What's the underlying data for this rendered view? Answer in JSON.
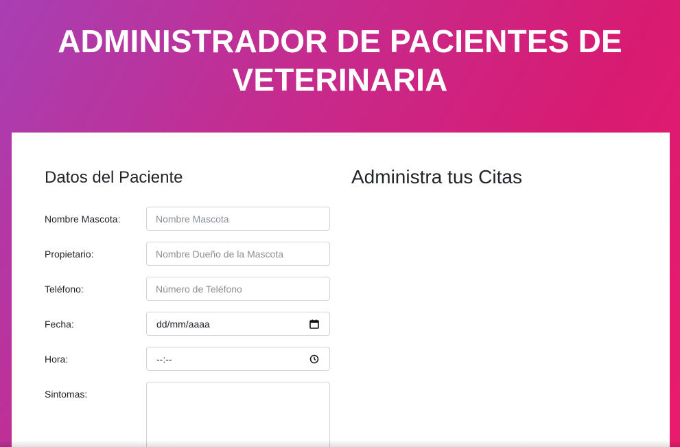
{
  "header": {
    "title": "ADMINISTRADOR DE PACIENTES DE VETERINARIA"
  },
  "form": {
    "title": "Datos del Paciente",
    "fields": [
      {
        "label": "Nombre Mascota:",
        "placeholder": "Nombre Mascota",
        "value": ""
      },
      {
        "label": "Propietario:",
        "placeholder": "Nombre Dueño de la Mascota",
        "value": ""
      },
      {
        "label": "Teléfono:",
        "placeholder": "Número de Teléfono",
        "value": ""
      },
      {
        "label": "Fecha:",
        "display": "dd/mm/aaaa",
        "icon": "calendar-icon"
      },
      {
        "label": "Hora:",
        "display": "--:--",
        "icon": "clock-icon"
      },
      {
        "label": "Sintomas:",
        "value": ""
      }
    ]
  },
  "citas": {
    "title": "Administra tus Citas"
  }
}
